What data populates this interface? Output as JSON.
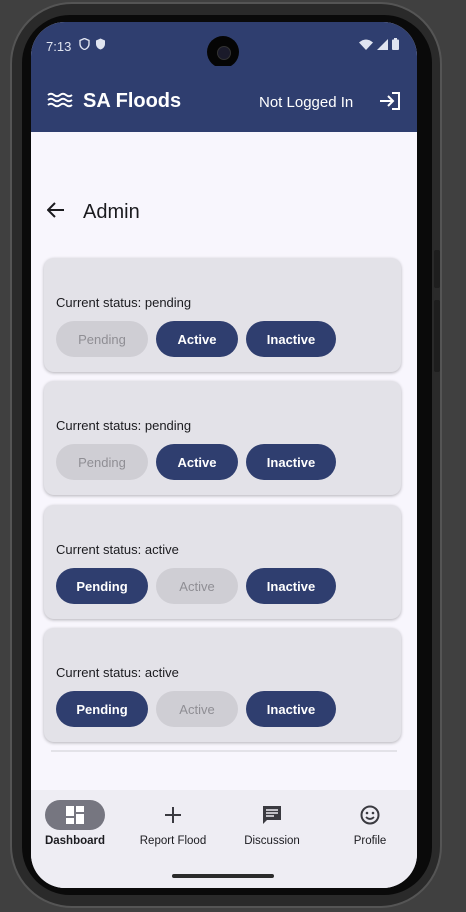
{
  "status_bar": {
    "time": "7:13"
  },
  "app_bar": {
    "title": "SA Floods",
    "login_status": "Not Logged In"
  },
  "page": {
    "title": "Admin"
  },
  "cards": [
    {
      "status": "Current status: pending",
      "buttons": [
        "Pending",
        "Active",
        "Inactive"
      ],
      "disabled": "Pending"
    },
    {
      "status": "Current status: pending",
      "buttons": [
        "Pending",
        "Active",
        "Inactive"
      ],
      "disabled": "Pending"
    },
    {
      "status": "Current status: active",
      "buttons": [
        "Pending",
        "Active",
        "Inactive"
      ],
      "disabled": "Active"
    },
    {
      "status": "Current status: active",
      "buttons": [
        "Pending",
        "Active",
        "Inactive"
      ],
      "disabled": "Active"
    }
  ],
  "bottom_nav": [
    {
      "label": "Dashboard",
      "icon": "dashboard-icon",
      "active": true
    },
    {
      "label": "Report Flood",
      "icon": "plus-icon",
      "active": false
    },
    {
      "label": "Discussion",
      "icon": "chat-icon",
      "active": false
    },
    {
      "label": "Profile",
      "icon": "smiley-icon",
      "active": false
    }
  ],
  "colors": {
    "primary": "#2f3e6f",
    "card": "#e3e2e8",
    "disabled": "#cfced4",
    "background": "#f8f6fd"
  }
}
